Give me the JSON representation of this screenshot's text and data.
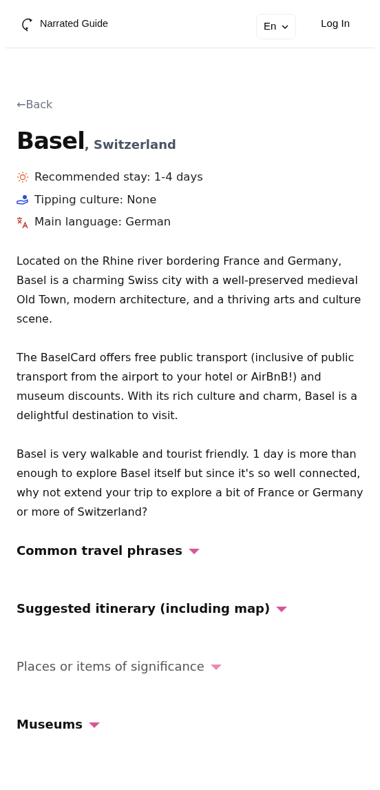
{
  "header": {
    "brand": "Narrated Guide",
    "language": "En",
    "login": "Log In"
  },
  "back": "←Back",
  "title": {
    "city": "Basel",
    "country": ", Switzerland"
  },
  "facts": [
    {
      "text": "Recommended stay: 1-4 days"
    },
    {
      "text": "Tipping culture: None"
    },
    {
      "text": "Main language: German"
    }
  ],
  "paragraphs": [
    "Located on the Rhine river bordering France and Germany, Basel is a charming Swiss city with a well-preserved medieval Old Town, modern architecture, and a thriving arts and culture scene.",
    "The BaselCard offers free public transport (inclusive of public transport from the airport to your hotel or AirBnB!) and museum discounts. With its rich culture and charm, Basel is a delightful destination to visit.",
    "Basel is very walkable and tourist friendly. 1 day is more than enough to explore Basel itself but since it's so well connected, why not extend your trip to explore a bit of France or Germany or more of Switzerland?"
  ],
  "sections": [
    {
      "label": "Common travel phrases",
      "expanded": false,
      "dimmed": false
    },
    {
      "label": "Suggested itinerary (including map)",
      "expanded": false,
      "dimmed": false
    },
    {
      "label": "Places or items of significance",
      "expanded": false,
      "dimmed": true
    },
    {
      "label": "Museums",
      "expanded": false,
      "dimmed": false
    }
  ]
}
